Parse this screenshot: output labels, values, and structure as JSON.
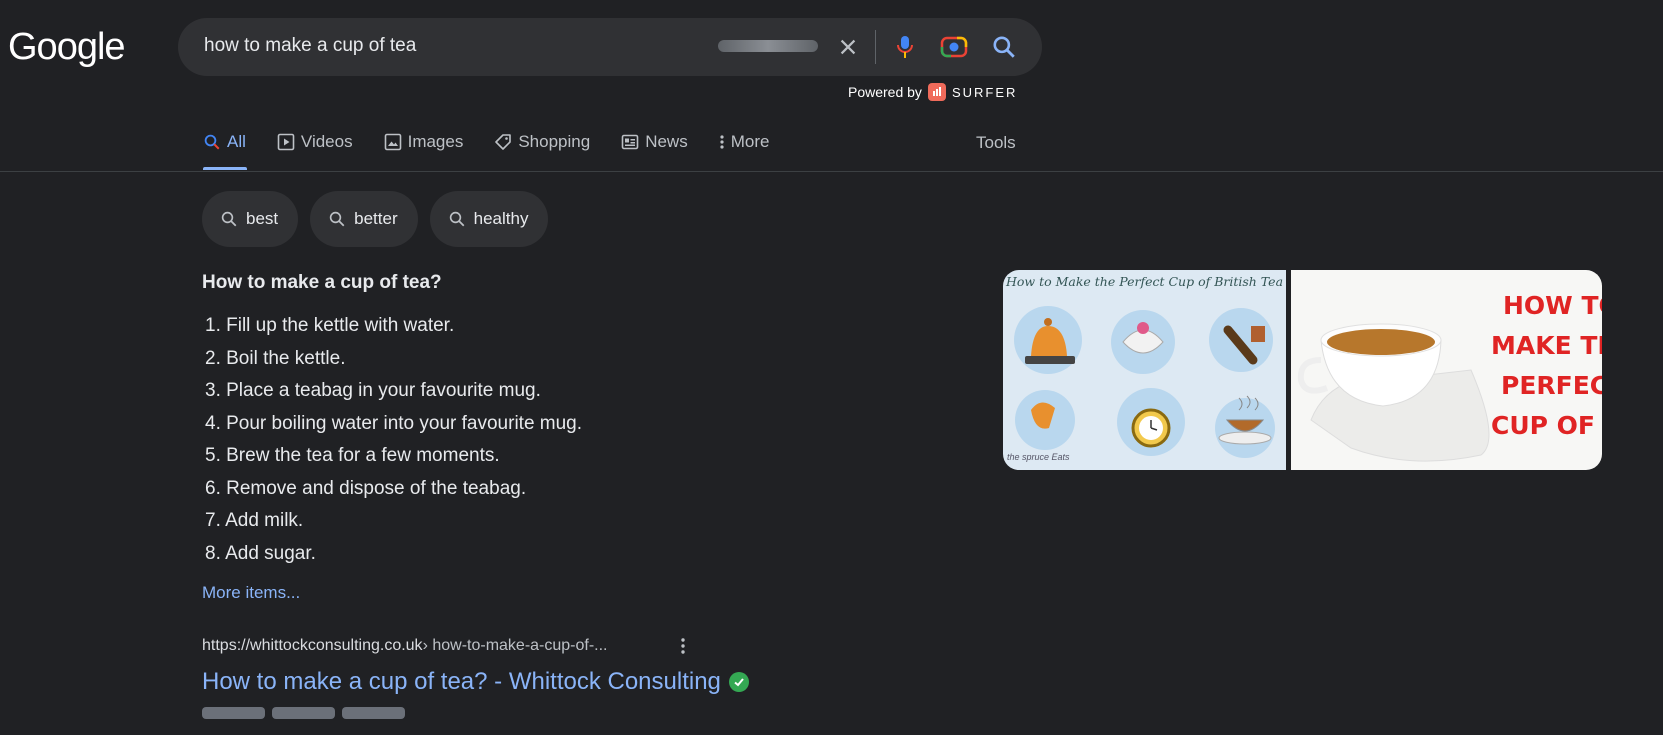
{
  "logo": {
    "text": "Google"
  },
  "search": {
    "query": "how to make a cup of tea"
  },
  "powered_by": {
    "label": "Powered by",
    "brand": "SURFER"
  },
  "tabs": [
    {
      "label": "All",
      "icon": "search-icon",
      "active": true
    },
    {
      "label": "Videos",
      "icon": "play-icon"
    },
    {
      "label": "Images",
      "icon": "image-icon"
    },
    {
      "label": "Shopping",
      "icon": "tag-icon"
    },
    {
      "label": "News",
      "icon": "news-icon"
    },
    {
      "label": "More",
      "icon": "more-vert-icon"
    }
  ],
  "tools_label": "Tools",
  "chips": [
    "best",
    "better",
    "healthy"
  ],
  "snippet": {
    "question": "How to make a cup of tea?",
    "steps": [
      "1. Fill up the kettle with water.",
      "2. Boil the kettle.",
      "3. Place a teabag in your favourite mug.",
      "4. Pour boiling water into your favourite mug.",
      "5. Brew the tea for a few moments.",
      "6. Remove and dispose of the teabag.",
      "7. Add milk.",
      "8. Add sugar."
    ],
    "more_items": "More items..."
  },
  "images": {
    "image1_title": "How to Make the Perfect Cup of British Tea",
    "image1_source": "the spruce Eats",
    "image2_text": [
      "HOW TO",
      "MAKE TH",
      "PERFECT",
      "CUP OF T"
    ]
  },
  "result": {
    "domain": "https://whittockconsulting.co.uk",
    "path": " › how-to-make-a-cup-of-...",
    "title": "How to make a cup of tea? - Whittock Consulting"
  },
  "colors": {
    "background": "#202124",
    "link": "#8ab4f8",
    "chip_bg": "#303134",
    "verified": "#34a853"
  }
}
